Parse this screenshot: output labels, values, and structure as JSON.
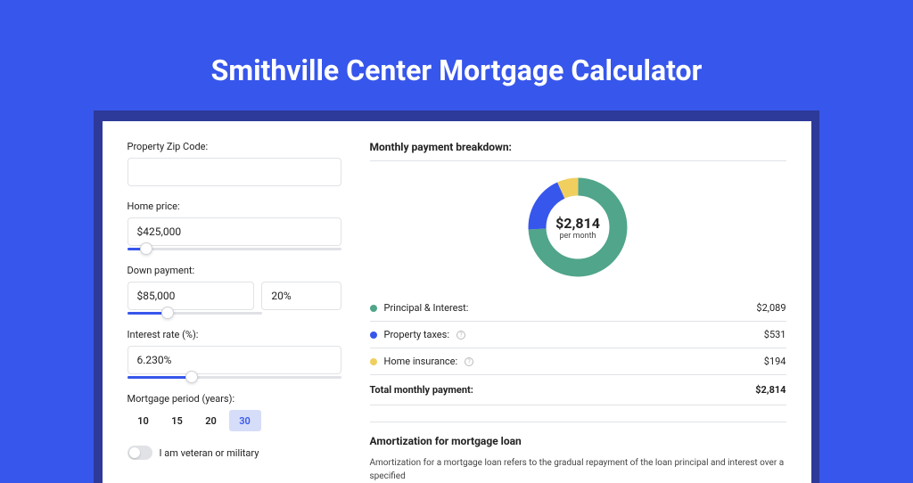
{
  "title": "Smithville Center Mortgage Calculator",
  "form": {
    "zip_label": "Property Zip Code:",
    "zip_value": "",
    "price_label": "Home price:",
    "price_value": "$425,000",
    "down_label": "Down payment:",
    "down_value": "$85,000",
    "down_pct": "20%",
    "rate_label": "Interest rate (%):",
    "rate_value": "6.230%",
    "period_label": "Mortgage period (years):",
    "periods": [
      "10",
      "15",
      "20",
      "30"
    ],
    "period_selected": "30",
    "veteran_label": "I am veteran or military"
  },
  "breakdown": {
    "title": "Monthly payment breakdown:",
    "donut_amount": "$2,814",
    "donut_sub": "per month",
    "rows": [
      {
        "label": "Principal & Interest:",
        "value": "$2,089",
        "color": "#50a58a",
        "info": false
      },
      {
        "label": "Property taxes:",
        "value": "$531",
        "color": "#3756eb",
        "info": true
      },
      {
        "label": "Home insurance:",
        "value": "$194",
        "color": "#f0cf5f",
        "info": true
      }
    ],
    "total_label": "Total monthly payment:",
    "total_value": "$2,814"
  },
  "amort": {
    "title": "Amortization for mortgage loan",
    "text": "Amortization for a mortgage loan refers to the gradual repayment of the loan principal and interest over a specified"
  },
  "chart_data": {
    "type": "pie",
    "title": "Monthly payment breakdown",
    "series": [
      {
        "name": "Principal & Interest",
        "value": 2089,
        "color": "#50a58a"
      },
      {
        "name": "Property taxes",
        "value": 531,
        "color": "#3756eb"
      },
      {
        "name": "Home insurance",
        "value": 194,
        "color": "#f0cf5f"
      }
    ],
    "total": 2814,
    "center_label": "$2,814 per month"
  }
}
